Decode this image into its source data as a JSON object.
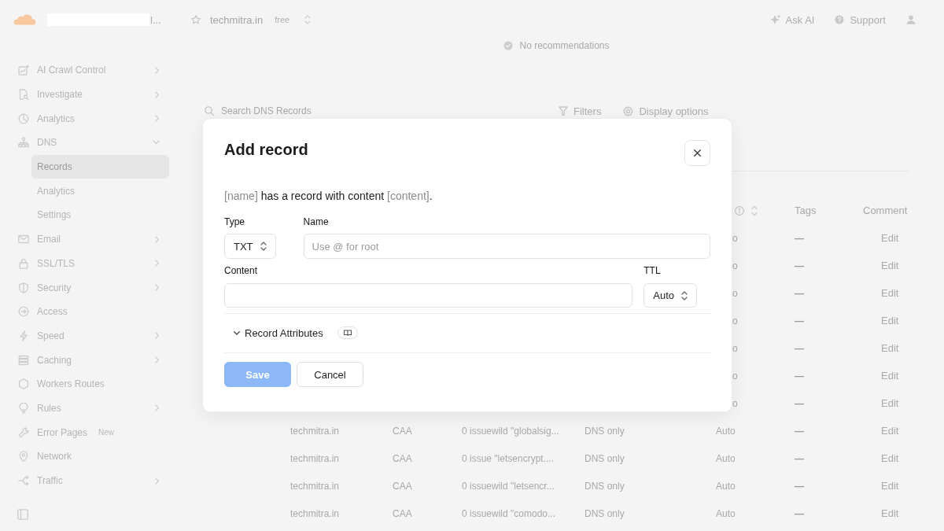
{
  "topbar": {
    "account_name": "l...",
    "zone": "techmitra.in",
    "plan": "free",
    "actions": [
      {
        "label": "Ask AI"
      },
      {
        "label": "Support"
      }
    ]
  },
  "sidebar": {
    "items": [
      {
        "label": "AI Crawl Control",
        "kind": "group",
        "expanded": false,
        "selected": false
      },
      {
        "label": "Investigate",
        "kind": "group",
        "expanded": false,
        "selected": false
      },
      {
        "label": "Analytics",
        "kind": "group",
        "expanded": false,
        "selected": false
      },
      {
        "label": "DNS",
        "kind": "group",
        "expanded": true,
        "selected": false,
        "children": [
          {
            "label": "Records",
            "selected": true
          },
          {
            "label": "Analytics",
            "selected": false
          },
          {
            "label": "Settings",
            "selected": false
          }
        ]
      },
      {
        "label": "Email",
        "kind": "group",
        "expanded": false,
        "selected": false
      },
      {
        "label": "SSL/TLS",
        "kind": "group",
        "expanded": false,
        "selected": false
      },
      {
        "label": "Security",
        "kind": "group",
        "expanded": false,
        "selected": false
      },
      {
        "label": "Access",
        "kind": "link",
        "selected": false
      },
      {
        "label": "Speed",
        "kind": "group",
        "expanded": false,
        "selected": false
      },
      {
        "label": "Caching",
        "kind": "group",
        "expanded": false,
        "selected": false
      },
      {
        "label": "Workers Routes",
        "kind": "link",
        "selected": false
      },
      {
        "label": "Rules",
        "kind": "group",
        "expanded": false,
        "selected": false
      },
      {
        "label": "Error Pages",
        "kind": "link",
        "selected": false,
        "badge": "New"
      },
      {
        "label": "Network",
        "kind": "link",
        "selected": false
      },
      {
        "label": "Traffic",
        "kind": "group",
        "expanded": false,
        "selected": false
      }
    ]
  },
  "main": {
    "recommendations": "No recommendations",
    "search": {
      "placeholder": "Search DNS Records"
    },
    "toolbar": [
      {
        "label": "Filters"
      },
      {
        "label": "Display options"
      }
    ],
    "table": {
      "headings": {
        "tags": "Tags",
        "comment": "Comment"
      },
      "rows": [
        {
          "ttl_fragment": "o",
          "tags": "—",
          "comment": "Edit"
        },
        {
          "ttl_fragment": "o",
          "tags": "—",
          "comment": "Edit"
        },
        {
          "ttl_fragment": "o",
          "tags": "—",
          "comment": "Edit"
        },
        {
          "ttl_fragment": "o",
          "tags": "—",
          "comment": "Edit"
        },
        {
          "ttl_fragment": "o",
          "tags": "—",
          "comment": "Edit"
        },
        {
          "ttl_fragment": "o",
          "tags": "—",
          "comment": "Edit"
        },
        {
          "ttl_fragment": "o",
          "tags": "—",
          "comment": "Edit"
        },
        {
          "name": "techmitra.in",
          "type": "CAA",
          "content": "0 issuewild \"globalsig...",
          "proxy": "DNS only",
          "ttl": "Auto",
          "tags": "—",
          "comment": "Edit"
        },
        {
          "name": "techmitra.in",
          "type": "CAA",
          "content": "0 issue \"letsencrypt....",
          "proxy": "DNS only",
          "ttl": "Auto",
          "tags": "—",
          "comment": "Edit"
        },
        {
          "name": "techmitra.in",
          "type": "CAA",
          "content": "0 issuewild \"letsencr...",
          "proxy": "DNS only",
          "ttl": "Auto",
          "tags": "—",
          "comment": "Edit"
        },
        {
          "name": "techmitra.in",
          "type": "CAA",
          "content": "0 issuewild \"comodo...",
          "proxy": "DNS only",
          "ttl": "Auto",
          "tags": "—",
          "comment": "Edit"
        }
      ]
    }
  },
  "modal": {
    "title": "Add record",
    "summary": [
      {
        "text": "[name]",
        "kind": "placeholder"
      },
      {
        "text": " has a record with content ",
        "kind": "plain"
      },
      {
        "text": "[content]",
        "kind": "placeholder"
      },
      {
        "text": ".",
        "kind": "plain"
      }
    ],
    "fields": [
      {
        "kind": "select",
        "label": "Type",
        "value": "TXT"
      },
      {
        "kind": "text",
        "label": "Name",
        "placeholder": "Use @ for root"
      },
      {
        "kind": "text",
        "label": "Content"
      },
      {
        "kind": "select",
        "label": "TTL",
        "value": "Auto"
      }
    ],
    "attributes": {
      "label": "Record Attributes",
      "expanded": false
    },
    "buttons": [
      {
        "label": "Save",
        "kind": "primary",
        "disabled": true
      },
      {
        "label": "Cancel",
        "kind": "secondary"
      }
    ]
  }
}
